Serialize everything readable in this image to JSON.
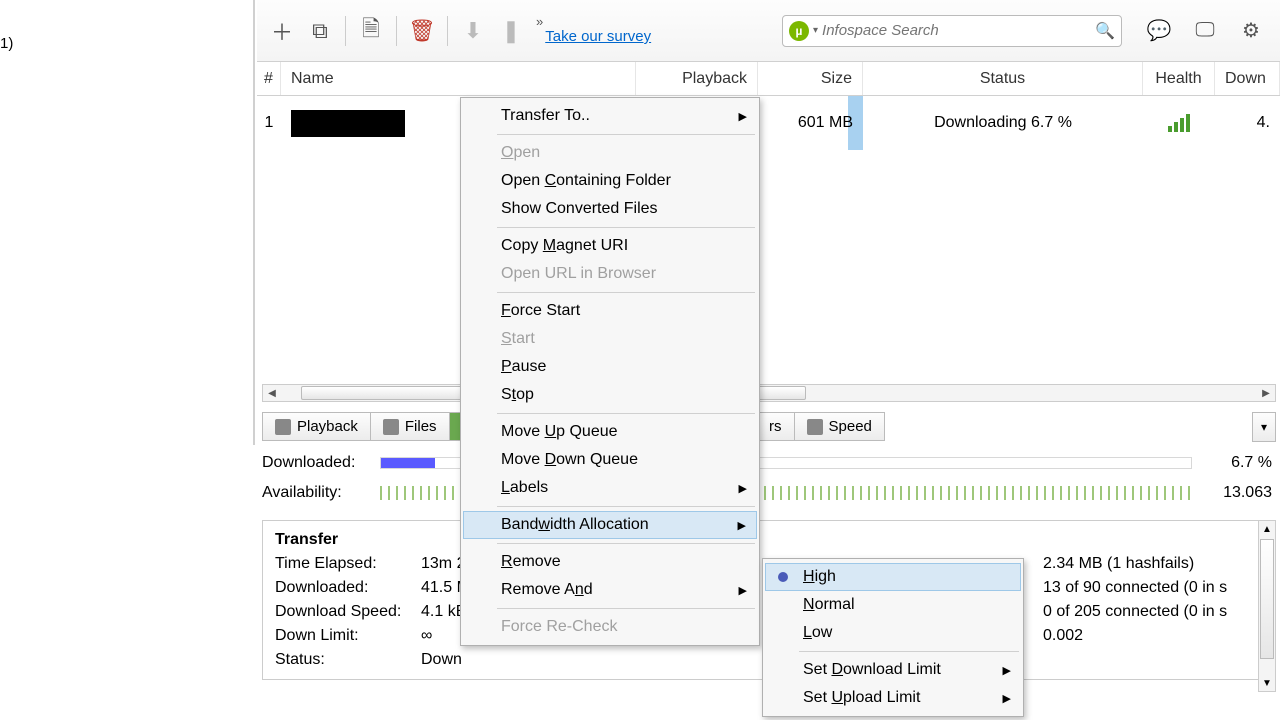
{
  "sidebar": {
    "count_text": "1)"
  },
  "toolbar": {
    "survey_link": "Take our survey",
    "search_placeholder": "Infospace Search"
  },
  "columns": {
    "num": "#",
    "name": "Name",
    "playback": "Playback",
    "size": "Size",
    "status": "Status",
    "health": "Health",
    "down": "Down"
  },
  "row": {
    "num": "1",
    "size": "601 MB",
    "status": "Downloading 6.7 %",
    "down": "4."
  },
  "tabs": {
    "playback": "Playback",
    "files": "Files",
    "trackers_suffix": "rs",
    "speed": "Speed"
  },
  "info": {
    "downloaded_lbl": "Downloaded:",
    "availability_lbl": "Availability:",
    "percent": "6.7 %",
    "avail_val": "13.063"
  },
  "transfer": {
    "header": "Transfer",
    "time_elapsed_lbl": "Time Elapsed:",
    "time_elapsed_val": "13m 2",
    "downloaded_lbl": "Downloaded:",
    "downloaded_val": "41.5 M",
    "dlspeed_lbl": "Download Speed:",
    "dlspeed_val": "4.1 kB",
    "downlimit_lbl": "Down Limit:",
    "downlimit_val": "∞",
    "status_lbl": "Status:",
    "status_val": "Down",
    "wasted": "2.34 MB (1 hashfails)",
    "seeds": "13 of 90 connected (0 in s",
    "peers": "0 of 205 connected (0 in s",
    "ratio": "0.002"
  },
  "context_menu": {
    "transfer_to": "Transfer To..",
    "open": "Open",
    "open_folder": "Open Containing Folder",
    "show_converted": "Show Converted Files",
    "copy_magnet": "Copy Magnet URI",
    "open_url": "Open URL in Browser",
    "force_start": "Force Start",
    "start": "Start",
    "pause": "Pause",
    "stop": "Stop",
    "move_up": "Move Up Queue",
    "move_down": "Move Down Queue",
    "labels": "Labels",
    "bandwidth": "Bandwidth Allocation",
    "remove": "Remove",
    "remove_and": "Remove And",
    "force_recheck": "Force Re-Check"
  },
  "submenu": {
    "high": "High",
    "normal": "Normal",
    "low": "Low",
    "set_dl_limit": "Set Download Limit",
    "set_ul_limit": "Set Upload Limit"
  }
}
